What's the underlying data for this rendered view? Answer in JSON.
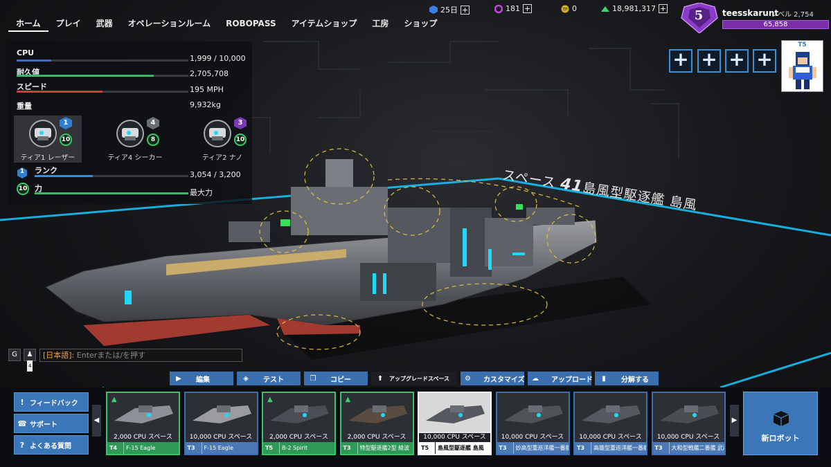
{
  "nav": {
    "tabs": [
      "ホーム",
      "プレイ",
      "武器",
      "オペレーションルーム",
      "ROBOPASS",
      "アイテムショップ",
      "工房",
      "ショップ"
    ],
    "active_tab": "ホーム"
  },
  "currencies": {
    "premium_days": "25日",
    "cosmetic": "181",
    "tokens": "0",
    "robits": "18,981,317"
  },
  "profile": {
    "rank": "5",
    "username": "teesskarunt",
    "level": "レベル 2,754",
    "xp": "65,858",
    "avatar_tier": "T5"
  },
  "stats": {
    "cpu_label": "CPU",
    "cpu_value": "1,999 / 10,000",
    "cpu_fill": 0.2,
    "hp_label": "耐久値",
    "hp_value": "2,705,708",
    "hp_fill": 0.8,
    "speed_label": "スピード",
    "speed_value": "195 MPH",
    "speed_fill": 0.5,
    "weight_label": "重量",
    "weight_value": "9,932kg",
    "rank_label": "ランク",
    "rank_value": "3,054 / 3,200",
    "rank_fill": 0.38,
    "rank_badge": "1",
    "power_label": "力",
    "power_value": "最大力",
    "power_fill": 1.0,
    "power_badge": "10"
  },
  "weapons": [
    {
      "name": "ティア1 レーザー",
      "tier": "1",
      "level": "10",
      "tier_color": "#2f7fd0"
    },
    {
      "name": "ティア4 シーカー",
      "tier": "4",
      "level": "8",
      "tier_color": "#6b6e75"
    },
    {
      "name": "ティア2 ナノ",
      "tier": "3",
      "level": "10",
      "tier_color": "#7a3ab8"
    }
  ],
  "robot_title": {
    "prefix": "スペース ",
    "number": "41",
    "name": "島風型駆逐艦 島風"
  },
  "chat": {
    "count": "4",
    "channel": "[日本語]:",
    "placeholder": " Enterまたは/を押す"
  },
  "toolbar": [
    {
      "label": "編集",
      "icon": "▶"
    },
    {
      "label": "テスト",
      "icon": "◈"
    },
    {
      "label": "コピー",
      "icon": "❐"
    },
    {
      "label": "アップグレードスペース",
      "icon": "⬆"
    },
    {
      "label": "カスタマイズ",
      "icon": "⚙"
    },
    {
      "label": "アップロード",
      "icon": "☁"
    },
    {
      "label": "分解する",
      "icon": "▮"
    }
  ],
  "side_buttons": [
    {
      "label": "フィードバック",
      "icon": "!"
    },
    {
      "label": "サポート",
      "icon": "☎"
    },
    {
      "label": "よくある質問",
      "icon": "?"
    }
  ],
  "robots": [
    {
      "cpu": "2,000 CPU スペース",
      "tier": "T4",
      "name": "F-15 Eagle",
      "style": "green"
    },
    {
      "cpu": "10,000 CPU スペース",
      "tier": "T3",
      "name": "F-15 Eagle",
      "style": "blue"
    },
    {
      "cpu": "2,000 CPU スペース",
      "tier": "T5",
      "name": "B-2 Spirit",
      "style": "green"
    },
    {
      "cpu": "2,000 CPU スペース",
      "tier": "T3",
      "name": "特型駆逐艦2型 綾波",
      "style": "green"
    },
    {
      "cpu": "10,000 CPU スペース",
      "tier": "T5",
      "name": "島風型駆逐艦 島風",
      "style": "sel"
    },
    {
      "cpu": "10,000 CPU スペース",
      "tier": "T3",
      "name": "妙高型重巡洋艦一番艦 妙高",
      "style": "blue"
    },
    {
      "cpu": "10,000 CPU スペース",
      "tier": "T3",
      "name": "高雄型重巡洋艦一番艦 高雄",
      "style": "blue"
    },
    {
      "cpu": "10,000 CPU スペース",
      "tier": "T3",
      "name": "大和型戦艦二番艦 武蔵",
      "style": "blue"
    }
  ],
  "new_robot_label": "新ロボット",
  "colors": {
    "accent_blue": "#3b76b8",
    "green": "#39c36b",
    "purple": "#7a2ea8",
    "floor_line": "#18c8ff"
  }
}
